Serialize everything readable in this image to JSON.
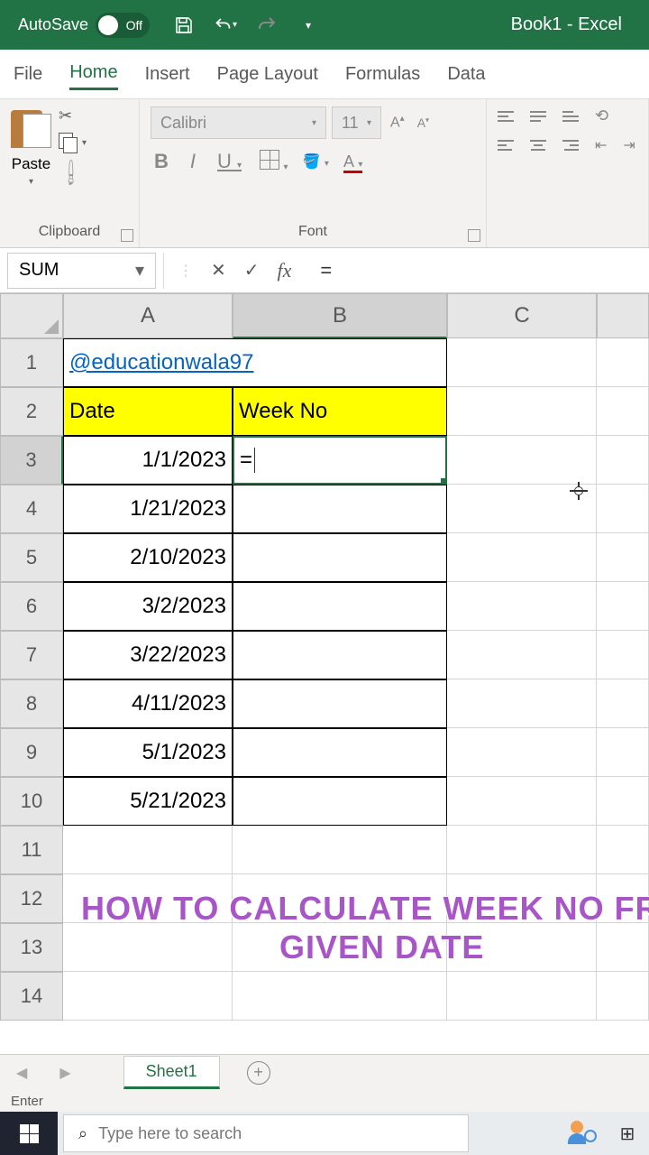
{
  "title_bar": {
    "autosave_label": "AutoSave",
    "autosave_state": "Off",
    "app_title": "Book1 - Excel"
  },
  "ribbon_tabs": [
    "File",
    "Home",
    "Insert",
    "Page Layout",
    "Formulas",
    "Data"
  ],
  "active_tab": "Home",
  "clipboard": {
    "paste_label": "Paste",
    "group_label": "Clipboard"
  },
  "font": {
    "name": "Calibri",
    "size": "11",
    "group_label": "Font"
  },
  "name_box": "SUM",
  "formula_value": "=",
  "columns": [
    "A",
    "B",
    "C"
  ],
  "rows": [
    "1",
    "2",
    "3",
    "4",
    "5",
    "6",
    "7",
    "8",
    "9",
    "10",
    "11",
    "12",
    "13",
    "14"
  ],
  "sheet": {
    "link_text": "@educationwala97",
    "headers": {
      "A": "Date",
      "B": "Week No"
    },
    "dates": [
      "1/1/2023",
      "1/21/2023",
      "2/10/2023",
      "3/2/2023",
      "3/22/2023",
      "4/11/2023",
      "5/1/2023",
      "5/21/2023"
    ],
    "active_cell_value": "="
  },
  "overlay": {
    "line1": "HOW TO CALCULATE WEEK NO FROM",
    "line2": "GIVEN DATE"
  },
  "sheet_tab": "Sheet1",
  "status": "Enter",
  "taskbar": {
    "search_placeholder": "Type here to search"
  }
}
